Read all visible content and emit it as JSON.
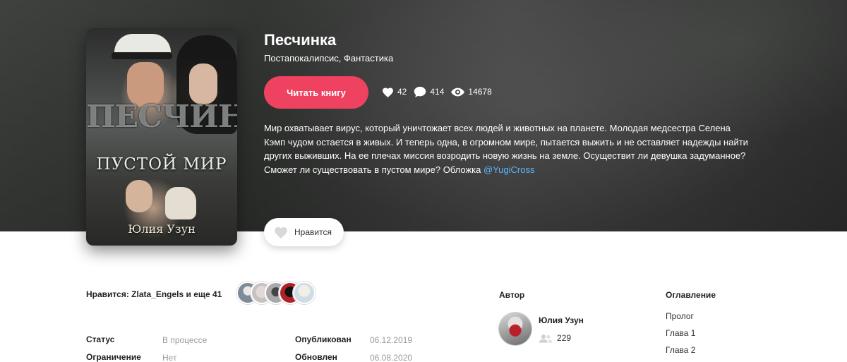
{
  "book": {
    "title": "Песчинка",
    "genres": "Постапокалипсис, Фантастика",
    "read_button": "Читать книгу",
    "stats": {
      "likes": "42",
      "comments": "414",
      "views": "14678"
    },
    "description": "Мир охватывает вирус, который уничтожает всех людей и животных на планете. Молодая медсестра Селена Кэмп чудом остается в живых. И теперь одна, в огромном мире, пытается выжить и не оставляет надежды найти других выживших. На ее плечах миссия возродить новую жизнь на земле. Осуществит ли девушка задуманное? Сможет ли существовать в пустом мире? Обложка ",
    "description_mention": "@YugiCross",
    "like_button": "Нравится",
    "cover": {
      "title_top": "ПЕСЧИНКА",
      "title_bottom": "ПУСТОЙ МИР",
      "author_sign": "Юлия Узун"
    }
  },
  "likes_row": "Нравится: Zlata_Engels и еще 41",
  "liker_avatars": [
    "#7d8a97",
    "#c7c2c0",
    "#a9a8ad",
    "#b2202a",
    "#cfdbe6"
  ],
  "meta": {
    "status_label": "Статус",
    "status_value": "В процессе",
    "limit_label": "Ограничение",
    "limit_value": "Нет",
    "published_label": "Опубликован",
    "published_value": "06.12.2019",
    "updated_label": "Обновлен",
    "updated_value": "06.08.2020"
  },
  "author": {
    "heading": "Автор",
    "name": "Юлия Узун",
    "followers": "229"
  },
  "toc": {
    "heading": "Оглавление",
    "items": [
      "Пролог",
      "Глава 1",
      "Глава 2"
    ]
  },
  "colors": {
    "accent": "#ef4261",
    "mention": "#5fb7ff"
  }
}
